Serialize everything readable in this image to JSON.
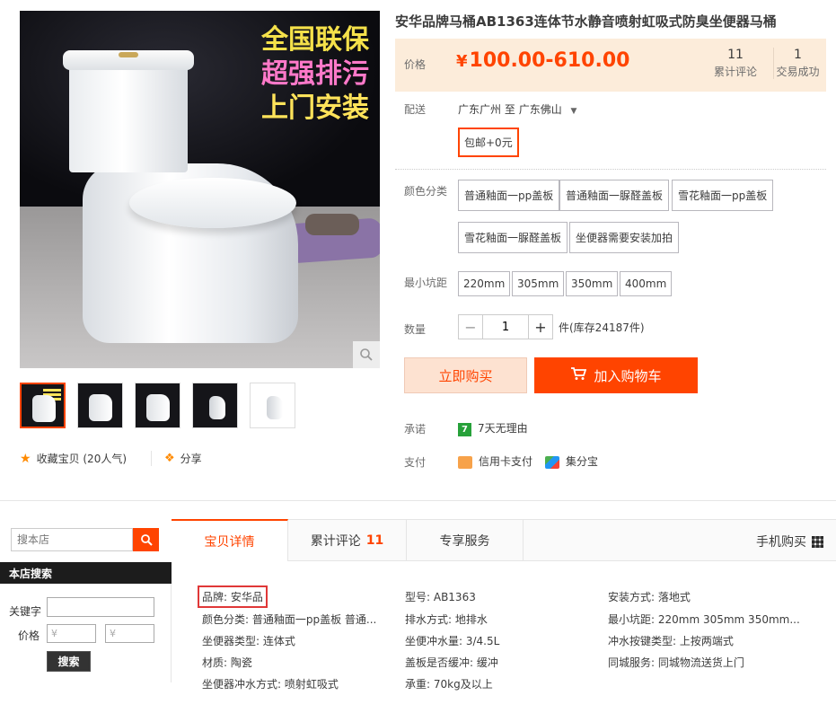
{
  "gallery": {
    "promo_lines": [
      "全国联保",
      "超强排污",
      "上门安装"
    ]
  },
  "product": {
    "title": "安华品牌马桶AB1363连体节水静音喷射虹吸式防臭坐便器马桶",
    "price_label": "价格",
    "price_currency": "¥",
    "price_range": "100.00-610.00",
    "reviews_count": "11",
    "reviews_label": "累计评论",
    "deals_count": "1",
    "deals_label": "交易成功"
  },
  "shipping": {
    "label": "配送",
    "from": "广东广州",
    "to_word": "至",
    "to": "广东佛山",
    "fee": "包邮+0元"
  },
  "options": {
    "color_label": "颜色分类",
    "colors": [
      "普通釉面一pp盖板",
      "普通釉面一脲醛盖板",
      "雪花釉面一pp盖板",
      "雪花釉面一脲醛盖板",
      "坐便器需要安装加拍"
    ],
    "pit_label": "最小坑距",
    "pits": [
      "220mm",
      "305mm",
      "350mm",
      "400mm"
    ]
  },
  "quantity": {
    "label": "数量",
    "minus": "−",
    "value": "1",
    "plus": "+",
    "stock_text": "件(库存24187件)"
  },
  "actions": {
    "buy_now": "立即购买",
    "add_cart": "加入购物车"
  },
  "promise": {
    "label": "承诺",
    "icon_text": "7",
    "text": "7天无理由"
  },
  "payment": {
    "label": "支付",
    "card": "信用卡支付",
    "jifen": "集分宝"
  },
  "social": {
    "favorite": "收藏宝贝 (20人气)",
    "share": "分享"
  },
  "store_sidebar": {
    "search_placeholder": "搜本店",
    "title": "本店搜索",
    "keyword_label": "关键字",
    "price_label": "价格",
    "price_min_placeholder": "¥",
    "price_max_placeholder": "¥",
    "search_button": "搜索"
  },
  "tabs": {
    "details": "宝贝详情",
    "reviews": "累计评论",
    "reviews_count": "11",
    "service": "专享服务",
    "mobile_buy": "手机购买"
  },
  "attributes": [
    [
      "品牌: 安华品",
      "型号: AB1363",
      "安装方式: 落地式"
    ],
    [
      "颜色分类: 普通釉面一pp盖板 普通...",
      "排水方式: 地排水",
      "最小坑距: 220mm 305mm 350mm..."
    ],
    [
      "坐便器类型: 连体式",
      "坐便冲水量: 3/4.5L",
      "冲水按键类型: 上按两端式"
    ],
    [
      "材质: 陶瓷",
      "盖板是否缓冲: 缓冲",
      "同城服务: 同城物流送货上门"
    ],
    [
      "坐便器冲水方式: 喷射虹吸式",
      "承重: 70kg及以上",
      ""
    ]
  ],
  "colors": {
    "accent": "#ff4400",
    "price_bg": "#fcecda",
    "buy_now_bg": "#fde2d1",
    "highlight_border": "#e03838"
  }
}
